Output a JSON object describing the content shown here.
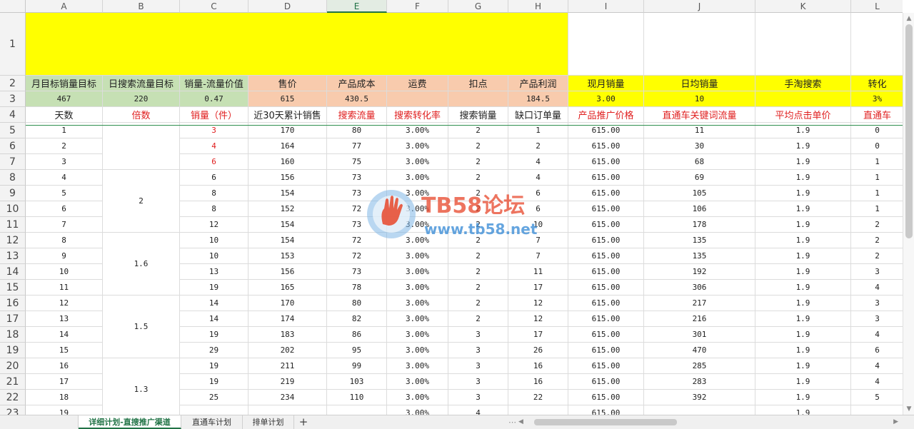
{
  "columns": [
    "A",
    "B",
    "C",
    "D",
    "E",
    "F",
    "G",
    "H",
    "I",
    "J",
    "K",
    "L"
  ],
  "selected_column": "E",
  "row_numbers": [
    "1",
    "2",
    "3",
    "4",
    "5",
    "6",
    "7",
    "8",
    "9",
    "10",
    "11",
    "12",
    "13",
    "14",
    "15",
    "16",
    "17",
    "18",
    "19",
    "20",
    "21",
    "22",
    "23"
  ],
  "summary": {
    "labels": [
      "月目标销量目标",
      "日搜索流量目标",
      "销量-流量价值",
      "售价",
      "产品成本",
      "运费",
      "扣点",
      "产品利润",
      "现月销量",
      "日均销量",
      "手淘搜索",
      "转化"
    ],
    "values": [
      "467",
      "220",
      "0.47",
      "615",
      "430.5",
      "",
      "",
      "184.5",
      "3.00",
      "10",
      "",
      "3%"
    ]
  },
  "headers": [
    "天数",
    "倍数",
    "销量（件）",
    "近30天累计销售",
    "搜索流量",
    "搜索转化率",
    "搜索销量",
    "缺口订单量",
    "产品推广价格",
    "直通车关键词流量",
    "平均点击单价",
    "直通车"
  ],
  "multipliers": [
    {
      "label": "",
      "rows": 3
    },
    {
      "label": "2",
      "rows": 4
    },
    {
      "label": "1.6",
      "rows": 4
    },
    {
      "label": "1.5",
      "rows": 4
    },
    {
      "label": "1.3",
      "rows": 4
    }
  ],
  "rows": [
    [
      "1",
      "3",
      "170",
      "80",
      "3.00%",
      "2",
      "1",
      "615.00",
      "11",
      "1.9",
      "0"
    ],
    [
      "2",
      "4",
      "164",
      "77",
      "3.00%",
      "2",
      "2",
      "615.00",
      "30",
      "1.9",
      "0"
    ],
    [
      "3",
      "6",
      "160",
      "75",
      "3.00%",
      "2",
      "4",
      "615.00",
      "68",
      "1.9",
      "1"
    ],
    [
      "4",
      "6",
      "156",
      "73",
      "3.00%",
      "2",
      "4",
      "615.00",
      "69",
      "1.9",
      "1"
    ],
    [
      "5",
      "8",
      "154",
      "73",
      "3.00%",
      "2",
      "6",
      "615.00",
      "105",
      "1.9",
      "1"
    ],
    [
      "6",
      "8",
      "152",
      "72",
      "3.00%",
      "2",
      "6",
      "615.00",
      "106",
      "1.9",
      "1"
    ],
    [
      "7",
      "12",
      "154",
      "73",
      "3.00%",
      "2",
      "10",
      "615.00",
      "178",
      "1.9",
      "2"
    ],
    [
      "8",
      "10",
      "154",
      "72",
      "3.00%",
      "2",
      "7",
      "615.00",
      "135",
      "1.9",
      "2"
    ],
    [
      "9",
      "10",
      "153",
      "72",
      "3.00%",
      "2",
      "7",
      "615.00",
      "135",
      "1.9",
      "2"
    ],
    [
      "10",
      "13",
      "156",
      "73",
      "3.00%",
      "2",
      "11",
      "615.00",
      "192",
      "1.9",
      "3"
    ],
    [
      "11",
      "19",
      "165",
      "78",
      "3.00%",
      "2",
      "17",
      "615.00",
      "306",
      "1.9",
      "4"
    ],
    [
      "12",
      "14",
      "170",
      "80",
      "3.00%",
      "2",
      "12",
      "615.00",
      "217",
      "1.9",
      "3"
    ],
    [
      "13",
      "14",
      "174",
      "82",
      "3.00%",
      "2",
      "12",
      "615.00",
      "216",
      "1.9",
      "3"
    ],
    [
      "14",
      "19",
      "183",
      "86",
      "3.00%",
      "3",
      "17",
      "615.00",
      "301",
      "1.9",
      "4"
    ],
    [
      "15",
      "29",
      "202",
      "95",
      "3.00%",
      "3",
      "26",
      "615.00",
      "470",
      "1.9",
      "6"
    ],
    [
      "16",
      "19",
      "211",
      "99",
      "3.00%",
      "3",
      "16",
      "615.00",
      "285",
      "1.9",
      "4"
    ],
    [
      "17",
      "19",
      "219",
      "103",
      "3.00%",
      "3",
      "16",
      "615.00",
      "283",
      "1.9",
      "4"
    ],
    [
      "18",
      "25",
      "234",
      "110",
      "3.00%",
      "3",
      "22",
      "615.00",
      "392",
      "1.9",
      "5"
    ]
  ],
  "partial_row": [
    "19",
    "",
    "",
    "",
    "",
    "3.00%",
    "4",
    "",
    "615.00",
    "",
    "1.9",
    ""
  ],
  "watermark": {
    "title": "TB58论坛",
    "url": "www.tb58.net"
  },
  "tabs": [
    "详细计划-直搜推广渠道",
    "直通车计划",
    "排单计划"
  ],
  "add_sheet_label": "+",
  "colors": {
    "yellow": "#ffff00",
    "green": "#c6e0b4",
    "peach": "#f8cbad",
    "red": "#e02020",
    "accent": "#217346"
  }
}
